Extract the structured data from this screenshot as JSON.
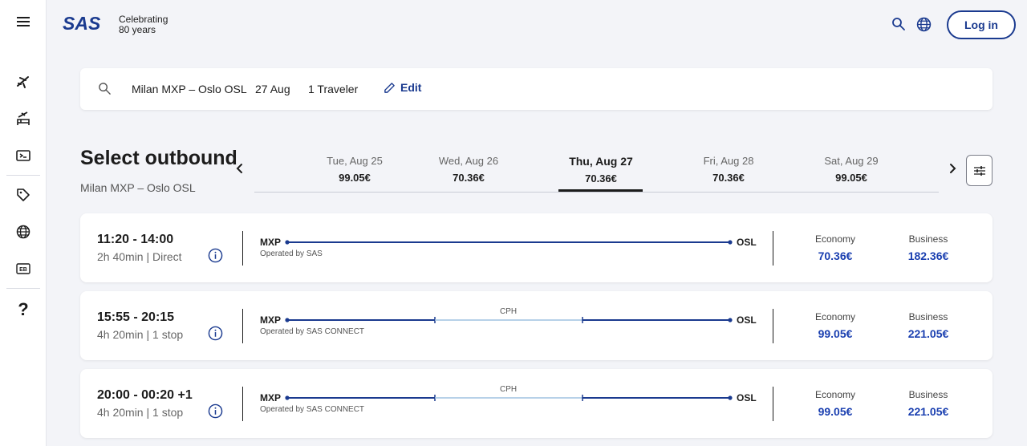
{
  "header": {
    "logo_text": "SAS",
    "tagline_line1": "Celebrating",
    "tagline_line2": "80 years",
    "login_label": "Log in"
  },
  "rail": {
    "items": [
      "menu-icon",
      "flight-icon",
      "flight-hotel-icon",
      "ticket-icon",
      "tag-icon",
      "globe-icon",
      "eurobonus-icon",
      "help-icon"
    ],
    "eurobonus_label": "EB",
    "help_label": "?"
  },
  "summary": {
    "route": "Milan MXP – Oslo OSL",
    "date": "27 Aug",
    "travelers": "1 Traveler",
    "edit_label": "Edit"
  },
  "outbound": {
    "title": "Select outbound",
    "subtitle": "Milan MXP – Oslo OSL"
  },
  "dates": [
    {
      "day": "Tue, Aug 25",
      "price": "99.05€",
      "active": false
    },
    {
      "day": "Wed, Aug 26",
      "price": "70.36€",
      "active": false
    },
    {
      "day": "Thu, Aug 27",
      "price": "70.36€",
      "active": true
    },
    {
      "day": "Fri, Aug 28",
      "price": "70.36€",
      "active": false
    },
    {
      "day": "Sat, Aug 29",
      "price": "99.05€",
      "active": false
    }
  ],
  "flights": [
    {
      "times": "11:20 - 14:00",
      "duration": "2h 40min",
      "stops": "Direct",
      "from": "MXP",
      "to": "OSL",
      "operator": "Operated by SAS",
      "via": "",
      "economy_label": "Economy",
      "economy_price": "70.36€",
      "business_label": "Business",
      "business_price": "182.36€"
    },
    {
      "times": "15:55 - 20:15",
      "duration": "4h 20min",
      "stops": "1 stop",
      "from": "MXP",
      "to": "OSL",
      "operator": "Operated by SAS CONNECT",
      "via": "CPH",
      "economy_label": "Economy",
      "economy_price": "99.05€",
      "business_label": "Business",
      "business_price": "221.05€"
    },
    {
      "times": "20:00 - 00:20 +1",
      "duration": "4h 20min",
      "stops": "1 stop",
      "from": "MXP",
      "to": "OSL",
      "operator": "Operated by SAS CONNECT",
      "via": "CPH",
      "economy_label": "Economy",
      "economy_price": "99.05€",
      "business_label": "Business",
      "business_price": "221.05€"
    }
  ],
  "colors": {
    "brand": "#1a3a8f",
    "price": "#1a3fb0",
    "route_line": "#1a3a8f",
    "layover_line": "#9fc2e0"
  }
}
